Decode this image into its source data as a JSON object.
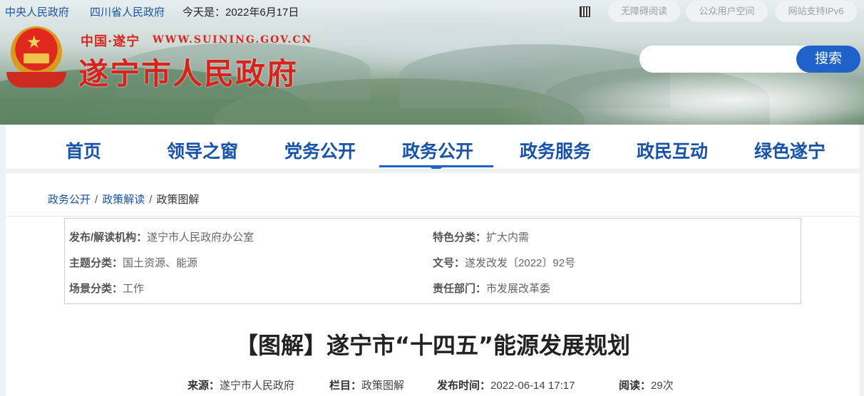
{
  "topbar": {
    "links": [
      "中央人民政府",
      "四川省人民政府"
    ],
    "date_text": "今天是：2022年6月17日",
    "pills": [
      "无障碍阅读",
      "公众用户空间",
      "网站支持IPv6"
    ]
  },
  "brand": {
    "small": "中国·遂宁",
    "url": "WWW.SUINING.GOV.CN",
    "title": "遂宁市人民政府"
  },
  "search": {
    "placeholder": "",
    "button_label": "搜索"
  },
  "nav": {
    "items": [
      "首页",
      "领导之窗",
      "党务公开",
      "政务公开",
      "政务服务",
      "政民互动",
      "绿色遂宁"
    ],
    "active": "政务公开"
  },
  "breadcrumb": {
    "items": [
      "政务公开",
      "政策解读"
    ],
    "current": "政策图解",
    "separator": "/"
  },
  "meta": {
    "publisher_key": "发布/解读机构：",
    "publisher": "遂宁市人民政府办公室",
    "feature_key": "特色分类：",
    "feature": "扩大内需",
    "topic_key": "主题分类：",
    "topic": "国土资源、能源",
    "docno_key": "文号：",
    "docno": "遂发改发〔2022〕92号",
    "scene_key": "场景分类：",
    "scene": "工作",
    "dept_key": "责任部门：",
    "dept": "市发展改革委"
  },
  "article": {
    "title": "【图解】遂宁市“十四五”能源发展规划",
    "source_key": "来源：",
    "source": "遂宁市人民政府",
    "column_key": "栏目：",
    "column": "政策图解",
    "time_key": "发布时间：",
    "time": "2022-06-14 17:17",
    "reads_key": "阅读：",
    "reads": "29次"
  },
  "colors": {
    "accent": "#1f63c9",
    "nav_text": "#1853a8",
    "brand_red": "#d3251d"
  }
}
